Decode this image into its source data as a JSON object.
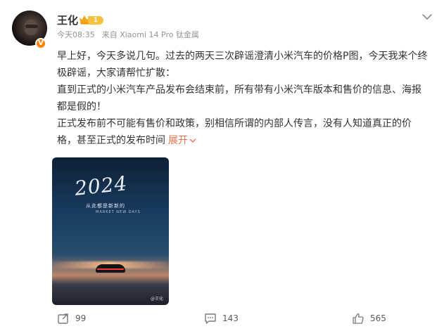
{
  "post": {
    "author": "王化",
    "level": "1",
    "verified_mark": "V",
    "time": "今天08:35",
    "source": "来自 Xiaomi 14 Pro 钛金属",
    "paragraphs": [
      "早上好，今天多说几句。过去的两天三次辟谣澄清小米汽车的价格P图，今天我来个终极辟谣，大家请帮忙扩散：",
      "直到正式的小米汽车产品发布会结束前，所有带有小米汽车版本和售价的信息、海报都是假的！",
      "正式发布前不可能有售价和政策，别相信所谓的内部人传言，没有人知道真正的价格，甚至正式的发布时间"
    ],
    "expand_label": "展开",
    "image": {
      "title": "2024",
      "subtitle": "从此都是新新的",
      "subtitle_en": "MARKET NEW DAYS",
      "watermark": "@王化"
    },
    "stats": {
      "reposts": "99",
      "comments": "143",
      "likes": "565"
    }
  },
  "colors": {
    "accent": "#eb7350",
    "verified": "#ff8200",
    "level_badge": "#f8c13d",
    "meta_text": "#939393"
  },
  "icons": [
    "chevron-down-icon",
    "crown-icon",
    "repost-icon",
    "comment-icon",
    "like-icon"
  ]
}
